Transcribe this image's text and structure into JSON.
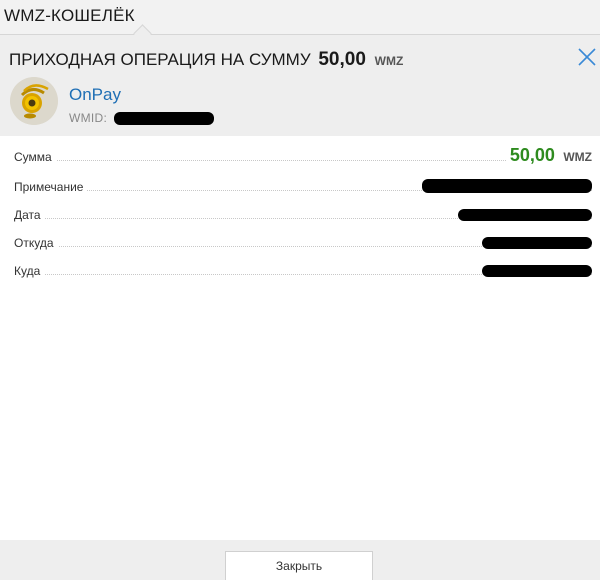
{
  "wallet": {
    "title": "WMZ-КОШЕЛЁК"
  },
  "operation": {
    "title_prefix": "ПРИХОДНАЯ ОПЕРАЦИЯ НА СУММУ",
    "amount": "50,00",
    "currency": "WMZ"
  },
  "merchant": {
    "name": "OnPay",
    "wmid_label": "WMID:",
    "avatar_icon": "onpay-logo-icon"
  },
  "details": {
    "sum_label": "Сумма",
    "sum_value": "50,00",
    "sum_currency": "WMZ",
    "note_label": "Примечание",
    "date_label": "Дата",
    "from_label": "Откуда",
    "to_label": "Куда"
  },
  "footer": {
    "close_label": "Закрыть"
  },
  "colors": {
    "amount_green": "#2e8b1f",
    "link_blue": "#1f6fb5",
    "close_icon": "#3a8ad6",
    "header_bg": "#eeeeee"
  }
}
